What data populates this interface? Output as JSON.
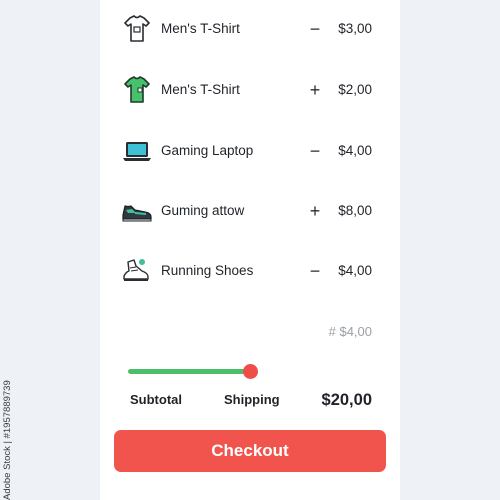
{
  "cart": {
    "items": [
      {
        "name": "Men's T-Shirt",
        "icon": "white-tshirt-icon",
        "action": "−",
        "price": "$3,00"
      },
      {
        "name": "Men's T-Shirt",
        "icon": "green-tshirt-icon",
        "action": "+",
        "price": "$2,00"
      },
      {
        "name": "Gaming Laptop",
        "icon": "laptop-icon",
        "action": "−",
        "price": "$4,00"
      },
      {
        "name": "Guming attow",
        "icon": "sneaker-icon",
        "action": "+",
        "price": "$8,00"
      },
      {
        "name": "Running Shoes",
        "icon": "running-shoes-icon",
        "action": "−",
        "price": "$4,00"
      }
    ],
    "misc_line": "# $4,00"
  },
  "summary": {
    "progress": 0.83,
    "subtotal_label": "Subtotal",
    "shipping_label": "Shipping",
    "total": "$20,00"
  },
  "actions": {
    "checkout_label": "Checkout"
  },
  "overlay": {
    "side_id": "Adobe Stock | #1957889739"
  },
  "colors": {
    "background": "#eef2f7",
    "card": "#ffffff",
    "accent_red": "#f0544d",
    "accent_green": "#4cbf6a"
  }
}
